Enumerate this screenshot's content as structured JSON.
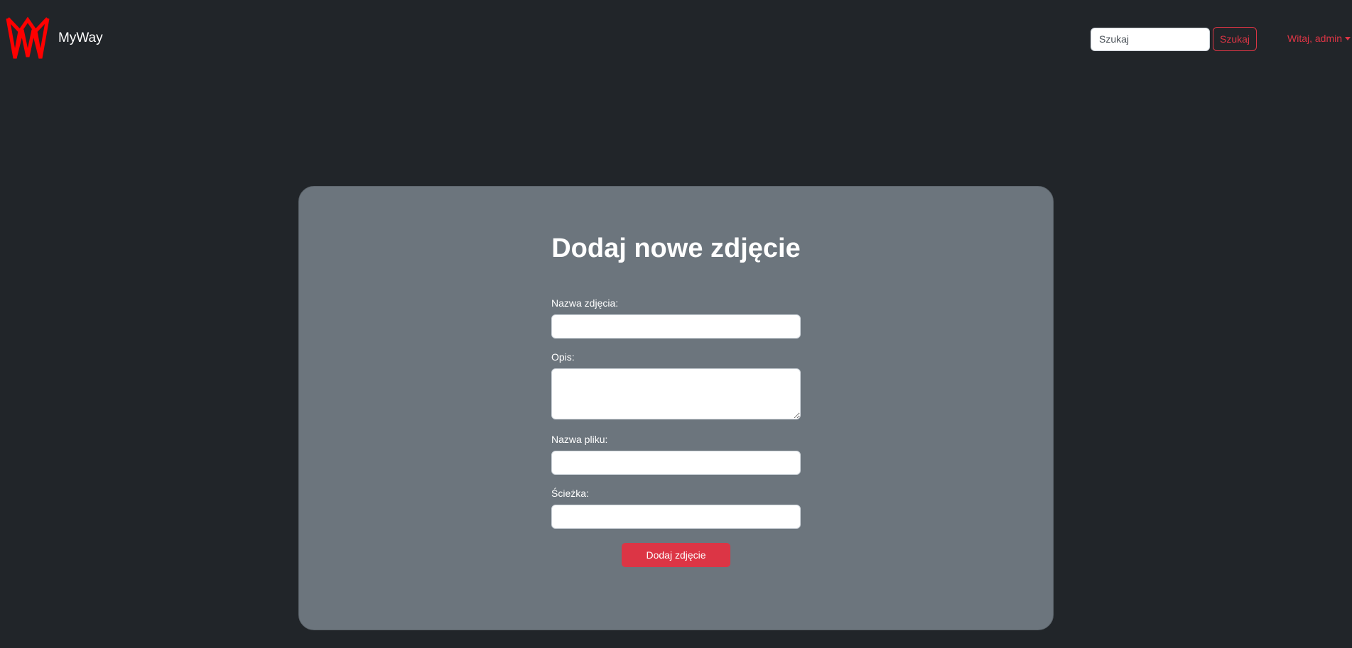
{
  "navbar": {
    "brand_name": "MyWay",
    "logo_icon": "myway-w-logo",
    "search": {
      "placeholder": "Szukaj",
      "value": "",
      "button_label": "Szukaj"
    },
    "user_menu_label": "Witaj, admin",
    "user_menu_icon": "caret-down-icon"
  },
  "form": {
    "title": "Dodaj nowe zdjęcie",
    "fields": [
      {
        "label": "Nazwa zdjęcia:",
        "value": ""
      },
      {
        "label": "Opis:",
        "value": ""
      },
      {
        "label": "Nazwa pliku:",
        "value": ""
      },
      {
        "label": "Ścieżka:",
        "value": ""
      }
    ],
    "submit_label": "Dodaj zdjęcie"
  },
  "colors": {
    "background": "#212529",
    "card": "#6c757d",
    "accent": "#dc3545",
    "logo": "#ff0000",
    "text": "#ffffff"
  }
}
